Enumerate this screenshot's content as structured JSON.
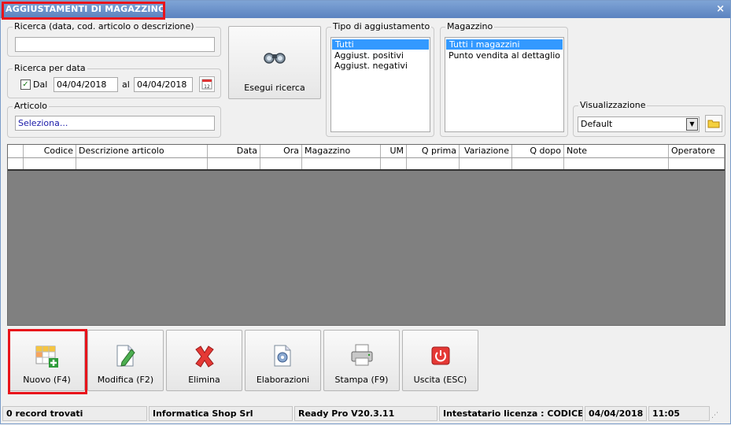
{
  "window": {
    "title": "AGGIUSTAMENTI DI MAGAZZINO",
    "close_icon": "×"
  },
  "search": {
    "legend": "Ricerca (data, cod. articolo o descrizione)",
    "value": ""
  },
  "date_search": {
    "legend": "Ricerca per data",
    "dal_label": "Dal",
    "from": "04/04/2018",
    "al_label": "al",
    "to": "04/04/2018",
    "checked": true
  },
  "articolo": {
    "legend": "Articolo",
    "value": "Seleziona..."
  },
  "search_button": {
    "label": "Esegui ricerca"
  },
  "tipo": {
    "legend": "Tipo di aggiustamento",
    "items": [
      "Tutti",
      "Aggiust. positivi",
      "Aggiust. negativi"
    ],
    "selected": 0
  },
  "magazzino": {
    "legend": "Magazzino",
    "items": [
      "Tutti i magazzini",
      "Punto vendita al dettaglio"
    ],
    "selected": 0
  },
  "visualizzazione": {
    "legend": "Visualizzazione",
    "value": "Default"
  },
  "grid": {
    "columns": [
      "",
      "Codice",
      "Descrizione articolo",
      "Data",
      "Ora",
      "Magazzino",
      "UM",
      "Q prima",
      "Variazione",
      "Q dopo",
      "Note",
      "Operatore"
    ]
  },
  "toolbar": {
    "nuovo": "Nuovo (F4)",
    "modifica": "Modifica (F2)",
    "elimina": "Elimina",
    "elaborazioni": "Elaborazioni",
    "stampa": "Stampa (F9)",
    "uscita": "Uscita (ESC)"
  },
  "status": {
    "records": "0 record trovati",
    "company": "Informatica Shop Srl",
    "version": "Ready Pro V20.3.11",
    "license": "Intestatario licenza : CODICE SR",
    "date": "04/04/2018",
    "time": "11:05"
  },
  "colors": {
    "title_bg": "#5b83c0",
    "highlight": "#e8141b",
    "selection": "#3399ff",
    "grid_bg": "#808080"
  }
}
